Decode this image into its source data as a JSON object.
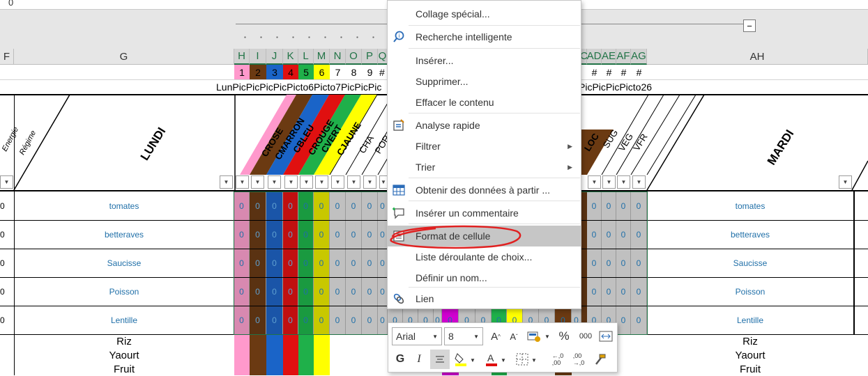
{
  "formula_bar": {
    "value": "0"
  },
  "columns": {
    "F": "F",
    "G": "G",
    "H": "H",
    "I": "I",
    "J": "J",
    "K": "K",
    "L": "L",
    "M": "M",
    "N": "N",
    "O": "O",
    "P": "P",
    "Q": "Q",
    "AC": "C",
    "AD": "AD",
    "AE": "AE",
    "AF": "AF",
    "AG": "AG",
    "AH": "AH"
  },
  "row2": {
    "h": "1",
    "i": "2",
    "j": "3",
    "k": "4",
    "l": "5",
    "m": "6",
    "n": "7",
    "o": "8",
    "p": "9",
    "q": "#",
    "ad": "#",
    "ae": "#",
    "af": "#",
    "ag": "#"
  },
  "row3": {
    "left": "LunPicPicPicPicPicto6Picto7PicPicPic",
    "right": "PicPicPicPicto26"
  },
  "headers": {
    "energie": "Energie",
    "regime": "Régime",
    "lundi": "LUNDI",
    "mardi": "MARDI",
    "diagonal": [
      "CROSE",
      "CMARRON",
      "CBLEU",
      "CROUGE",
      "CVERT",
      "CJAUNE",
      "CHA",
      "POR"
    ],
    "diagonal_right": [
      "LOC",
      "SUG",
      "VEG",
      "VFR"
    ]
  },
  "rows": [
    {
      "left_value": "0",
      "food": "tomates",
      "food_right": "tomates"
    },
    {
      "left_value": "0",
      "food": "betteraves",
      "food_right": "betteraves"
    },
    {
      "left_value": "0",
      "food": "Saucisse",
      "food_right": "Saucisse"
    },
    {
      "left_value": "0",
      "food": "Poisson",
      "food_right": "Poisson"
    },
    {
      "left_value": "0",
      "food": "Lentille",
      "food_right": "Lentille"
    }
  ],
  "lower_rows": [
    "Riz",
    "Yaourt",
    "Fruit"
  ],
  "cell_zero": "0",
  "context_menu": {
    "items": [
      {
        "label": "Collage spécial...",
        "icon": ""
      },
      {
        "label": "Recherche intelligente",
        "icon": "smart-lookup-icon"
      },
      {
        "label": "Insérer...",
        "icon": ""
      },
      {
        "label": "Supprimer...",
        "icon": ""
      },
      {
        "label": "Effacer le contenu",
        "icon": ""
      },
      {
        "label": "Analyse rapide",
        "icon": "quick-analysis-icon"
      },
      {
        "label": "Filtrer",
        "icon": "",
        "submenu": true
      },
      {
        "label": "Trier",
        "icon": "",
        "submenu": true
      },
      {
        "label": "Obtenir des données à partir ...",
        "icon": "table-icon"
      },
      {
        "label": "Insérer un commentaire",
        "icon": "comment-icon"
      },
      {
        "label": "Format de cellule",
        "icon": "format-cells-icon",
        "highlighted": true
      },
      {
        "label": "Liste déroulante de choix...",
        "icon": ""
      },
      {
        "label": "Définir un nom...",
        "icon": ""
      },
      {
        "label": "Lien",
        "icon": "link-icon"
      }
    ]
  },
  "mini_toolbar": {
    "font": "Arial",
    "size": "8",
    "bold": "G",
    "italic": "I",
    "percent": "%",
    "thousands": "000"
  },
  "colors": {
    "pink": "#ff99cc",
    "brown": "#6b3a12",
    "blue": "#1a64c8",
    "red": "#e01010",
    "green": "#1fb04a",
    "yellow": "#ffff00",
    "gray": "#c0c0c0",
    "magenta": "#d100d1",
    "accent": "#217346",
    "annotation": "#e02020"
  }
}
